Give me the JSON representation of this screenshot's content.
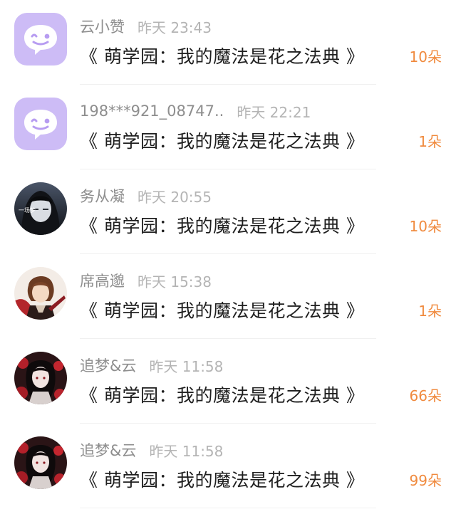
{
  "gifts": [
    {
      "avatar_icon": "default-chat-bubble-avatar",
      "username": "云小赞",
      "time": "昨天 23:43",
      "book_title": "《 萌学园：我的魔法是花之法典 》",
      "amount": "10朵"
    },
    {
      "avatar_icon": "default-chat-bubble-avatar",
      "username": "198***921_08747..",
      "time": "昨天 22:21",
      "book_title": "《 萌学园：我的魔法是花之法典 》",
      "amount": "1朵"
    },
    {
      "avatar_icon": "dark-anime-avatar",
      "avatar_caption": "一场梦",
      "username": "务从凝",
      "time": "昨天 20:55",
      "book_title": "《 萌学园：我的魔法是花之法典 》",
      "amount": "10朵"
    },
    {
      "avatar_icon": "anime-character-avatar",
      "username": "席高邈",
      "time": "昨天 15:38",
      "book_title": "《 萌学园：我的魔法是花之法典 》",
      "amount": "1朵"
    },
    {
      "avatar_icon": "anime-character-avatar",
      "username": "追梦&云",
      "time": "昨天 11:58",
      "book_title": "《 萌学园：我的魔法是花之法典 》",
      "amount": "66朵"
    },
    {
      "avatar_icon": "anime-character-avatar",
      "username": "追梦&云",
      "time": "昨天 11:58",
      "book_title": "《 萌学园：我的魔法是花之法典 》",
      "amount": "99朵"
    }
  ],
  "colors": {
    "username": "#8e8e8e",
    "time": "#b4b4b4",
    "title": "#1e1e1e",
    "amount": "#f08a3e",
    "default_avatar": "#cdbcf6"
  }
}
